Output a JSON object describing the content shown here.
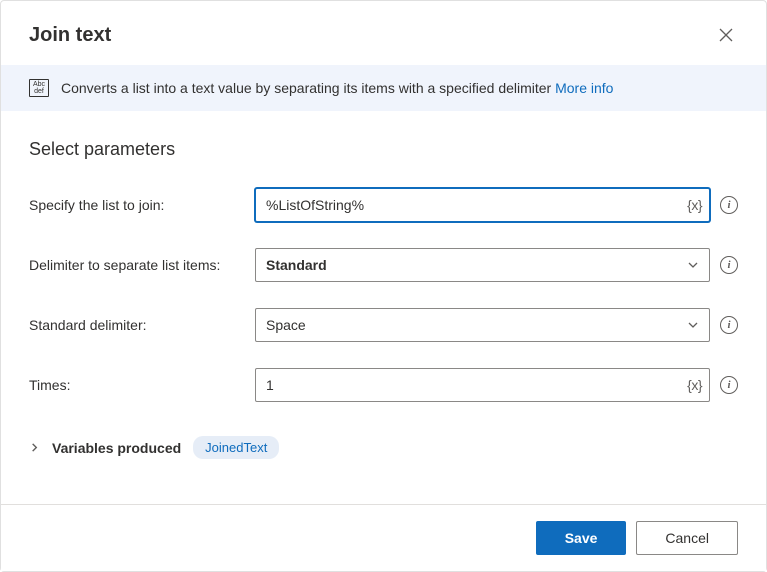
{
  "dialog": {
    "title": "Join text",
    "banner_text": "Converts a list into a text value by separating its items with a specified delimiter",
    "more_info": "More info",
    "section_title": "Select parameters"
  },
  "fields": {
    "list": {
      "label": "Specify the list to join:",
      "value": "%ListOfString%",
      "var_token": "{x}"
    },
    "delimiter": {
      "label": "Delimiter to separate list items:",
      "value": "Standard"
    },
    "standard_delimiter": {
      "label": "Standard delimiter:",
      "value": "Space"
    },
    "times": {
      "label": "Times:",
      "value": "1",
      "var_token": "{x}"
    }
  },
  "variables": {
    "label": "Variables produced",
    "pill": "JoinedText"
  },
  "buttons": {
    "save": "Save",
    "cancel": "Cancel"
  }
}
